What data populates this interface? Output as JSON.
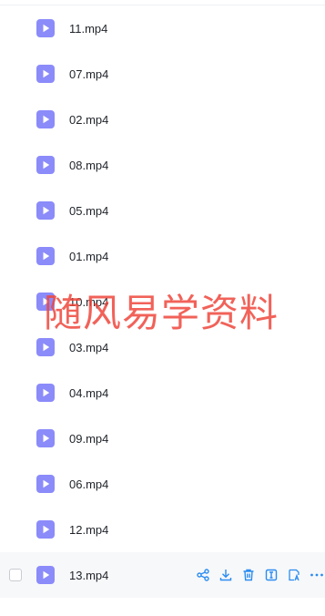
{
  "files": [
    {
      "name": "11.mp4"
    },
    {
      "name": "07.mp4"
    },
    {
      "name": "02.mp4"
    },
    {
      "name": "08.mp4"
    },
    {
      "name": "05.mp4"
    },
    {
      "name": "01.mp4"
    },
    {
      "name": "10.mp4"
    },
    {
      "name": "03.mp4"
    },
    {
      "name": "04.mp4"
    },
    {
      "name": "09.mp4"
    },
    {
      "name": "06.mp4"
    },
    {
      "name": "12.mp4"
    },
    {
      "name": "13.mp4"
    }
  ],
  "hovered_row_index": 12,
  "row_actions": [
    "share-icon",
    "download-icon",
    "delete-icon",
    "rename-icon",
    "ai-summary-icon",
    "more-icon"
  ],
  "watermark": "随风易学资料",
  "colors": {
    "file_icon": "#8b8bfa",
    "action_icon": "#2b8cf0",
    "watermark": "#ee463c"
  }
}
